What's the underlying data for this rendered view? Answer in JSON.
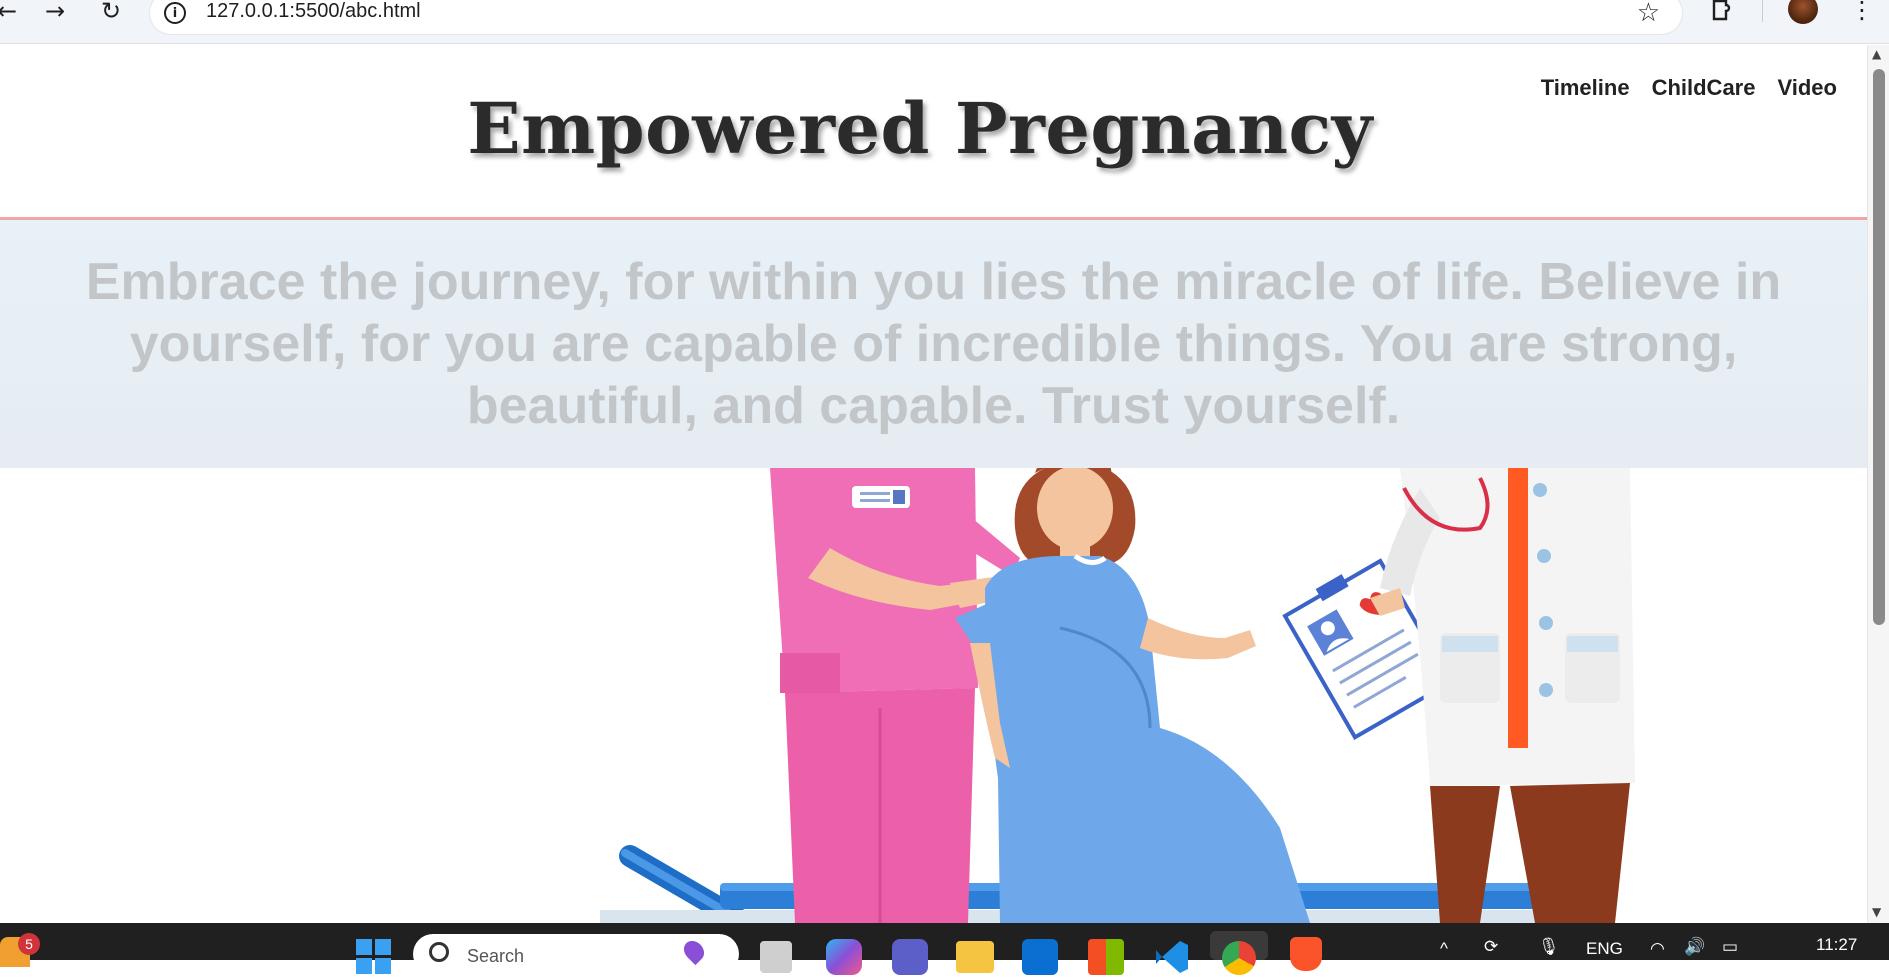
{
  "browser": {
    "url": "127.0.0.1:5500/abc.html"
  },
  "page": {
    "title": "Empowered Pregnancy",
    "nav": [
      {
        "label": "Timeline"
      },
      {
        "label": "ChildCare"
      },
      {
        "label": "Video"
      }
    ],
    "quote": "Embrace the journey, for within you lies the miracle of life. Believe in yourself, for you are capable of incredible things. You are strong, beautiful, and capable. Trust yourself."
  },
  "taskbar": {
    "notification_count": "5",
    "search_placeholder": "Search",
    "language": "ENG",
    "time": "11:27"
  },
  "colors": {
    "divider": "#f1a5a5",
    "banner_bg": "#e8f1f8",
    "quote_text": "#c2c6c9",
    "nurse_scrubs": "#f06eb6",
    "patient_gown": "#6ea8ea",
    "doctor_tie": "#ff5a23",
    "bed": "#2d7ed6"
  }
}
